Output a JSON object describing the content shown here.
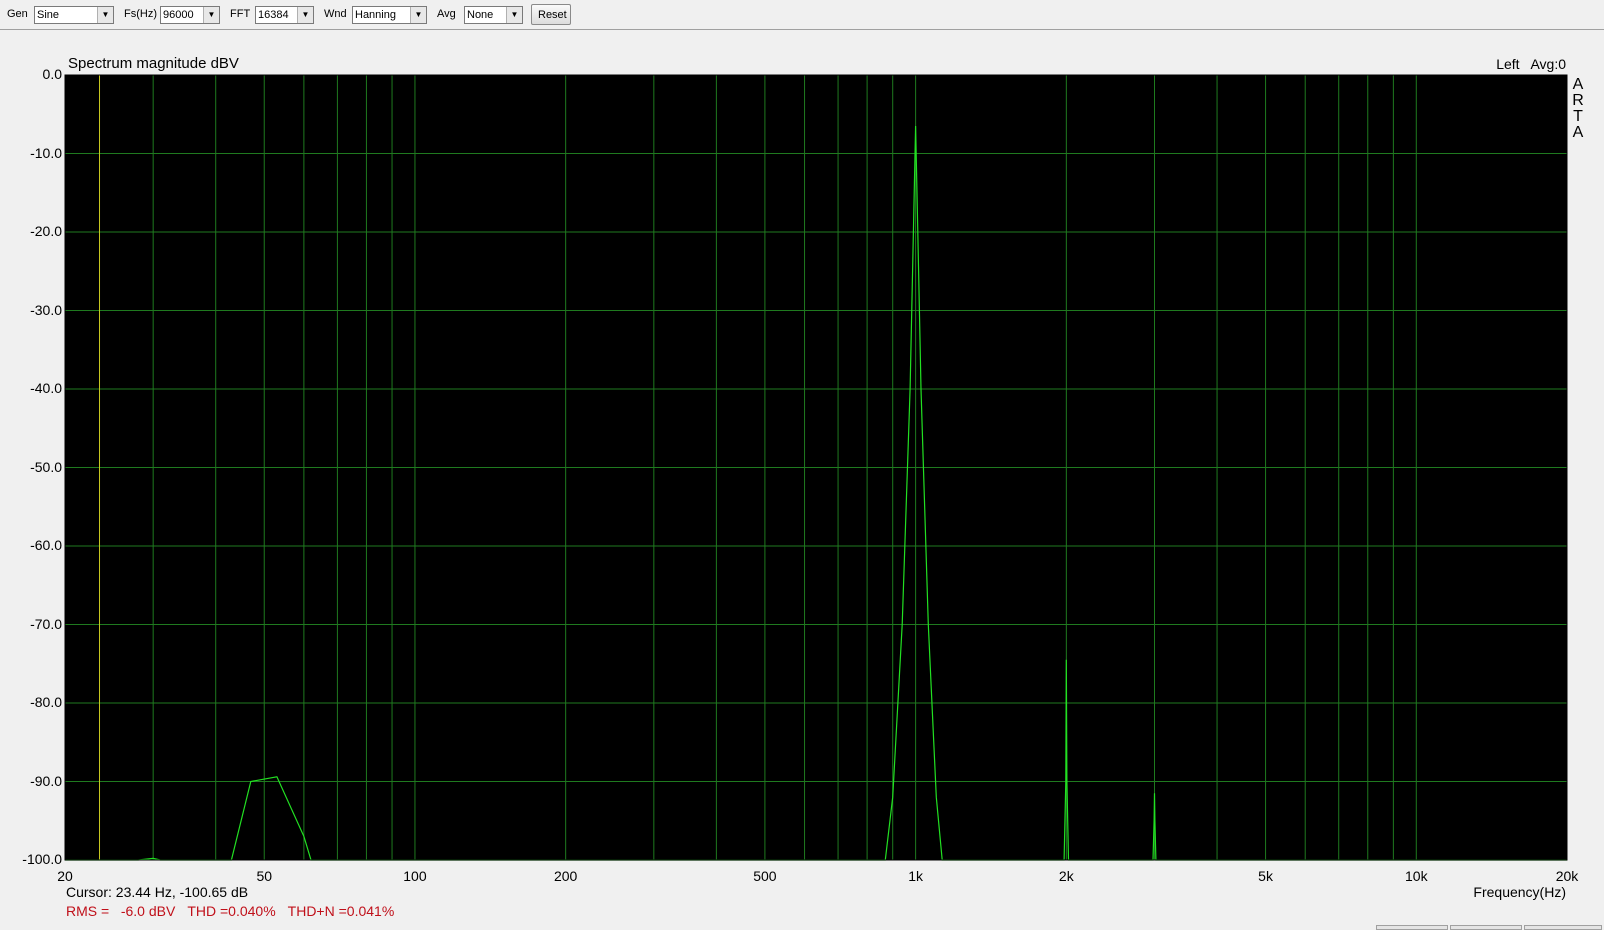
{
  "toolbar": {
    "gen": {
      "label": "Gen",
      "value": "Sine"
    },
    "fs": {
      "label": "Fs(Hz)",
      "value": "96000"
    },
    "fft": {
      "label": "FFT",
      "value": "16384"
    },
    "wnd": {
      "label": "Wnd",
      "value": "Hanning"
    },
    "avg": {
      "label": "Avg",
      "value": "None"
    },
    "reset_label": "Reset"
  },
  "plot": {
    "title": "Spectrum magnitude dBV",
    "channel": "Left",
    "avg_status": "Avg:0",
    "logo_letters": [
      "A",
      "R",
      "T",
      "A"
    ]
  },
  "readout": {
    "cursor": "Cursor: 23.44 Hz, -100.65 dB",
    "rms": "RMS =   -6.0 dBV",
    "thd": "THD =0.040%",
    "thdn": "THD+N =0.041%"
  },
  "colors": {
    "plot_bg": "#000000",
    "grid": "#1f7a1f",
    "trace": "#22e022",
    "cursor": "#c8c820",
    "measurement_text": "#c0101a"
  },
  "chart_data": {
    "type": "line",
    "title": "Spectrum magnitude dBV",
    "xlabel": "Frequency(Hz)",
    "ylabel": "",
    "x_scale": "log",
    "xlim": [
      20,
      20000
    ],
    "ylim": [
      -100,
      0
    ],
    "grid": true,
    "x_ticks": [
      {
        "value": 20,
        "label": "20"
      },
      {
        "value": 50,
        "label": "50"
      },
      {
        "value": 100,
        "label": "100"
      },
      {
        "value": 200,
        "label": "200"
      },
      {
        "value": 500,
        "label": "500"
      },
      {
        "value": 1000,
        "label": "1k"
      },
      {
        "value": 2000,
        "label": "2k"
      },
      {
        "value": 5000,
        "label": "5k"
      },
      {
        "value": 10000,
        "label": "10k"
      },
      {
        "value": 20000,
        "label": "20k"
      }
    ],
    "y_ticks": [
      {
        "value": 0,
        "label": "0.0"
      },
      {
        "value": -10,
        "label": "-10.0"
      },
      {
        "value": -20,
        "label": "-20.0"
      },
      {
        "value": -30,
        "label": "-30.0"
      },
      {
        "value": -40,
        "label": "-40.0"
      },
      {
        "value": -50,
        "label": "-50.0"
      },
      {
        "value": -60,
        "label": "-60.0"
      },
      {
        "value": -70,
        "label": "-70.0"
      },
      {
        "value": -80,
        "label": "-80.0"
      },
      {
        "value": -90,
        "label": "-90.0"
      },
      {
        "value": -100,
        "label": "-100.0"
      }
    ],
    "cursor_x": 23.44,
    "series": [
      {
        "x": [
          20,
          28,
          30,
          31,
          43,
          47,
          53,
          60,
          62,
          850,
          870,
          900,
          940,
          975,
          990,
          1000,
          1010,
          1025,
          1060,
          1100,
          1130,
          1160,
          1980,
          1995,
          2000,
          2005,
          2020,
          2980,
          2995,
          3000,
          3005,
          3020,
          20000
        ],
        "y": [
          -100,
          -100,
          -99.8,
          -100,
          -100,
          -90,
          -89.4,
          -97,
          -100,
          -100,
          -100,
          -92,
          -70,
          -40,
          -20,
          -6.5,
          -20,
          -40,
          -70,
          -92,
          -100,
          -100,
          -100,
          -90,
          -74.5,
          -90,
          -100,
          -100,
          -95,
          -91.5,
          -95,
          -100,
          -100
        ]
      }
    ]
  }
}
